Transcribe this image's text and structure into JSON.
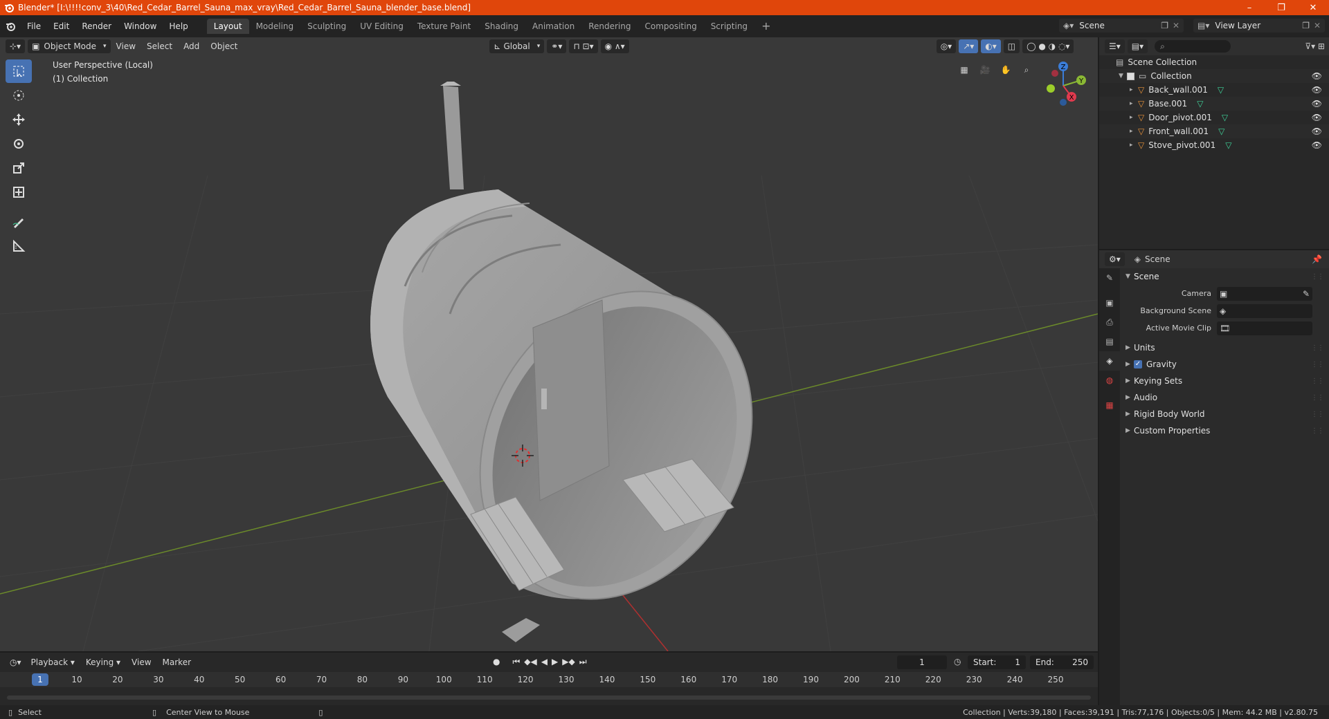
{
  "window": {
    "title": "Blender* [I:\\!!!!conv_3\\40\\Red_Cedar_Barrel_Sauna_max_vray\\Red_Cedar_Barrel_Sauna_blender_base.blend]",
    "controls": [
      "–",
      "❐",
      "✕"
    ]
  },
  "menu": [
    "File",
    "Edit",
    "Render",
    "Window",
    "Help"
  ],
  "workspaces": [
    {
      "label": "Layout",
      "active": true
    },
    {
      "label": "Modeling"
    },
    {
      "label": "Sculpting"
    },
    {
      "label": "UV Editing"
    },
    {
      "label": "Texture Paint"
    },
    {
      "label": "Shading"
    },
    {
      "label": "Animation"
    },
    {
      "label": "Rendering"
    },
    {
      "label": "Compositing"
    },
    {
      "label": "Scripting"
    }
  ],
  "scene_name": "Scene",
  "view_layer": "View Layer",
  "viewport": {
    "mode": "Object Mode",
    "menus": [
      "View",
      "Select",
      "Add",
      "Object"
    ],
    "orientation": "Global",
    "info_line1": "User Perspective (Local)",
    "info_line2": "(1) Collection",
    "gizmo": {
      "x": "X",
      "y": "Y",
      "z": "Z"
    }
  },
  "outliner": {
    "root": "Scene Collection",
    "collection": "Collection",
    "objects": [
      "Back_wall.001",
      "Base.001",
      "Door_pivot.001",
      "Front_wall.001",
      "Stove_pivot.001"
    ]
  },
  "properties": {
    "context": "Scene",
    "panel": "Scene",
    "camera_label": "Camera",
    "bg_scene_label": "Background Scene",
    "movie_clip_label": "Active Movie Clip",
    "subpanels": [
      "Units",
      "Gravity",
      "Keying Sets",
      "Audio",
      "Rigid Body World",
      "Custom Properties"
    ]
  },
  "timeline": {
    "menus": [
      "Playback",
      "Keying",
      "View",
      "Marker"
    ],
    "current_frame": "1",
    "start_label": "Start:",
    "start": "1",
    "end_label": "End:",
    "end": "250",
    "ticks": [
      "10",
      "20",
      "30",
      "40",
      "50",
      "60",
      "70",
      "80",
      "90",
      "100",
      "110",
      "120",
      "130",
      "140",
      "150",
      "160",
      "170",
      "180",
      "190",
      "200",
      "210",
      "220",
      "230",
      "240",
      "250"
    ]
  },
  "status": {
    "select": "Select",
    "center_view": "Center View to Mouse",
    "stats": "Collection | Verts:39,180 | Faces:39,191 | Tris:77,176 | Objects:0/5 | Mem: 44.2 MB | v2.80.75"
  },
  "colors": {
    "title_bar": "#e0460b",
    "accent": "#4772b3",
    "mesh_icon": "#e8923a",
    "data_icon": "#3fd49b"
  }
}
